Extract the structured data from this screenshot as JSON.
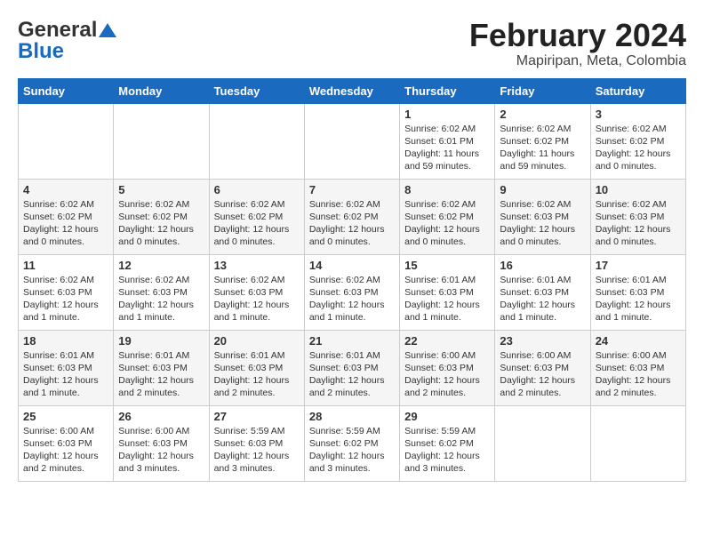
{
  "header": {
    "logo_general": "General",
    "logo_blue": "Blue",
    "title": "February 2024",
    "subtitle": "Mapiripan, Meta, Colombia"
  },
  "days_of_week": [
    "Sunday",
    "Monday",
    "Tuesday",
    "Wednesday",
    "Thursday",
    "Friday",
    "Saturday"
  ],
  "weeks": [
    [
      {
        "day": "",
        "info": ""
      },
      {
        "day": "",
        "info": ""
      },
      {
        "day": "",
        "info": ""
      },
      {
        "day": "",
        "info": ""
      },
      {
        "day": "1",
        "info": "Sunrise: 6:02 AM\nSunset: 6:01 PM\nDaylight: 11 hours and 59 minutes."
      },
      {
        "day": "2",
        "info": "Sunrise: 6:02 AM\nSunset: 6:02 PM\nDaylight: 11 hours and 59 minutes."
      },
      {
        "day": "3",
        "info": "Sunrise: 6:02 AM\nSunset: 6:02 PM\nDaylight: 12 hours and 0 minutes."
      }
    ],
    [
      {
        "day": "4",
        "info": "Sunrise: 6:02 AM\nSunset: 6:02 PM\nDaylight: 12 hours and 0 minutes."
      },
      {
        "day": "5",
        "info": "Sunrise: 6:02 AM\nSunset: 6:02 PM\nDaylight: 12 hours and 0 minutes."
      },
      {
        "day": "6",
        "info": "Sunrise: 6:02 AM\nSunset: 6:02 PM\nDaylight: 12 hours and 0 minutes."
      },
      {
        "day": "7",
        "info": "Sunrise: 6:02 AM\nSunset: 6:02 PM\nDaylight: 12 hours and 0 minutes."
      },
      {
        "day": "8",
        "info": "Sunrise: 6:02 AM\nSunset: 6:02 PM\nDaylight: 12 hours and 0 minutes."
      },
      {
        "day": "9",
        "info": "Sunrise: 6:02 AM\nSunset: 6:03 PM\nDaylight: 12 hours and 0 minutes."
      },
      {
        "day": "10",
        "info": "Sunrise: 6:02 AM\nSunset: 6:03 PM\nDaylight: 12 hours and 0 minutes."
      }
    ],
    [
      {
        "day": "11",
        "info": "Sunrise: 6:02 AM\nSunset: 6:03 PM\nDaylight: 12 hours and 1 minute."
      },
      {
        "day": "12",
        "info": "Sunrise: 6:02 AM\nSunset: 6:03 PM\nDaylight: 12 hours and 1 minute."
      },
      {
        "day": "13",
        "info": "Sunrise: 6:02 AM\nSunset: 6:03 PM\nDaylight: 12 hours and 1 minute."
      },
      {
        "day": "14",
        "info": "Sunrise: 6:02 AM\nSunset: 6:03 PM\nDaylight: 12 hours and 1 minute."
      },
      {
        "day": "15",
        "info": "Sunrise: 6:01 AM\nSunset: 6:03 PM\nDaylight: 12 hours and 1 minute."
      },
      {
        "day": "16",
        "info": "Sunrise: 6:01 AM\nSunset: 6:03 PM\nDaylight: 12 hours and 1 minute."
      },
      {
        "day": "17",
        "info": "Sunrise: 6:01 AM\nSunset: 6:03 PM\nDaylight: 12 hours and 1 minute."
      }
    ],
    [
      {
        "day": "18",
        "info": "Sunrise: 6:01 AM\nSunset: 6:03 PM\nDaylight: 12 hours and 1 minute."
      },
      {
        "day": "19",
        "info": "Sunrise: 6:01 AM\nSunset: 6:03 PM\nDaylight: 12 hours and 2 minutes."
      },
      {
        "day": "20",
        "info": "Sunrise: 6:01 AM\nSunset: 6:03 PM\nDaylight: 12 hours and 2 minutes."
      },
      {
        "day": "21",
        "info": "Sunrise: 6:01 AM\nSunset: 6:03 PM\nDaylight: 12 hours and 2 minutes."
      },
      {
        "day": "22",
        "info": "Sunrise: 6:00 AM\nSunset: 6:03 PM\nDaylight: 12 hours and 2 minutes."
      },
      {
        "day": "23",
        "info": "Sunrise: 6:00 AM\nSunset: 6:03 PM\nDaylight: 12 hours and 2 minutes."
      },
      {
        "day": "24",
        "info": "Sunrise: 6:00 AM\nSunset: 6:03 PM\nDaylight: 12 hours and 2 minutes."
      }
    ],
    [
      {
        "day": "25",
        "info": "Sunrise: 6:00 AM\nSunset: 6:03 PM\nDaylight: 12 hours and 2 minutes."
      },
      {
        "day": "26",
        "info": "Sunrise: 6:00 AM\nSunset: 6:03 PM\nDaylight: 12 hours and 3 minutes."
      },
      {
        "day": "27",
        "info": "Sunrise: 5:59 AM\nSunset: 6:03 PM\nDaylight: 12 hours and 3 minutes."
      },
      {
        "day": "28",
        "info": "Sunrise: 5:59 AM\nSunset: 6:02 PM\nDaylight: 12 hours and 3 minutes."
      },
      {
        "day": "29",
        "info": "Sunrise: 5:59 AM\nSunset: 6:02 PM\nDaylight: 12 hours and 3 minutes."
      },
      {
        "day": "",
        "info": ""
      },
      {
        "day": "",
        "info": ""
      }
    ]
  ]
}
